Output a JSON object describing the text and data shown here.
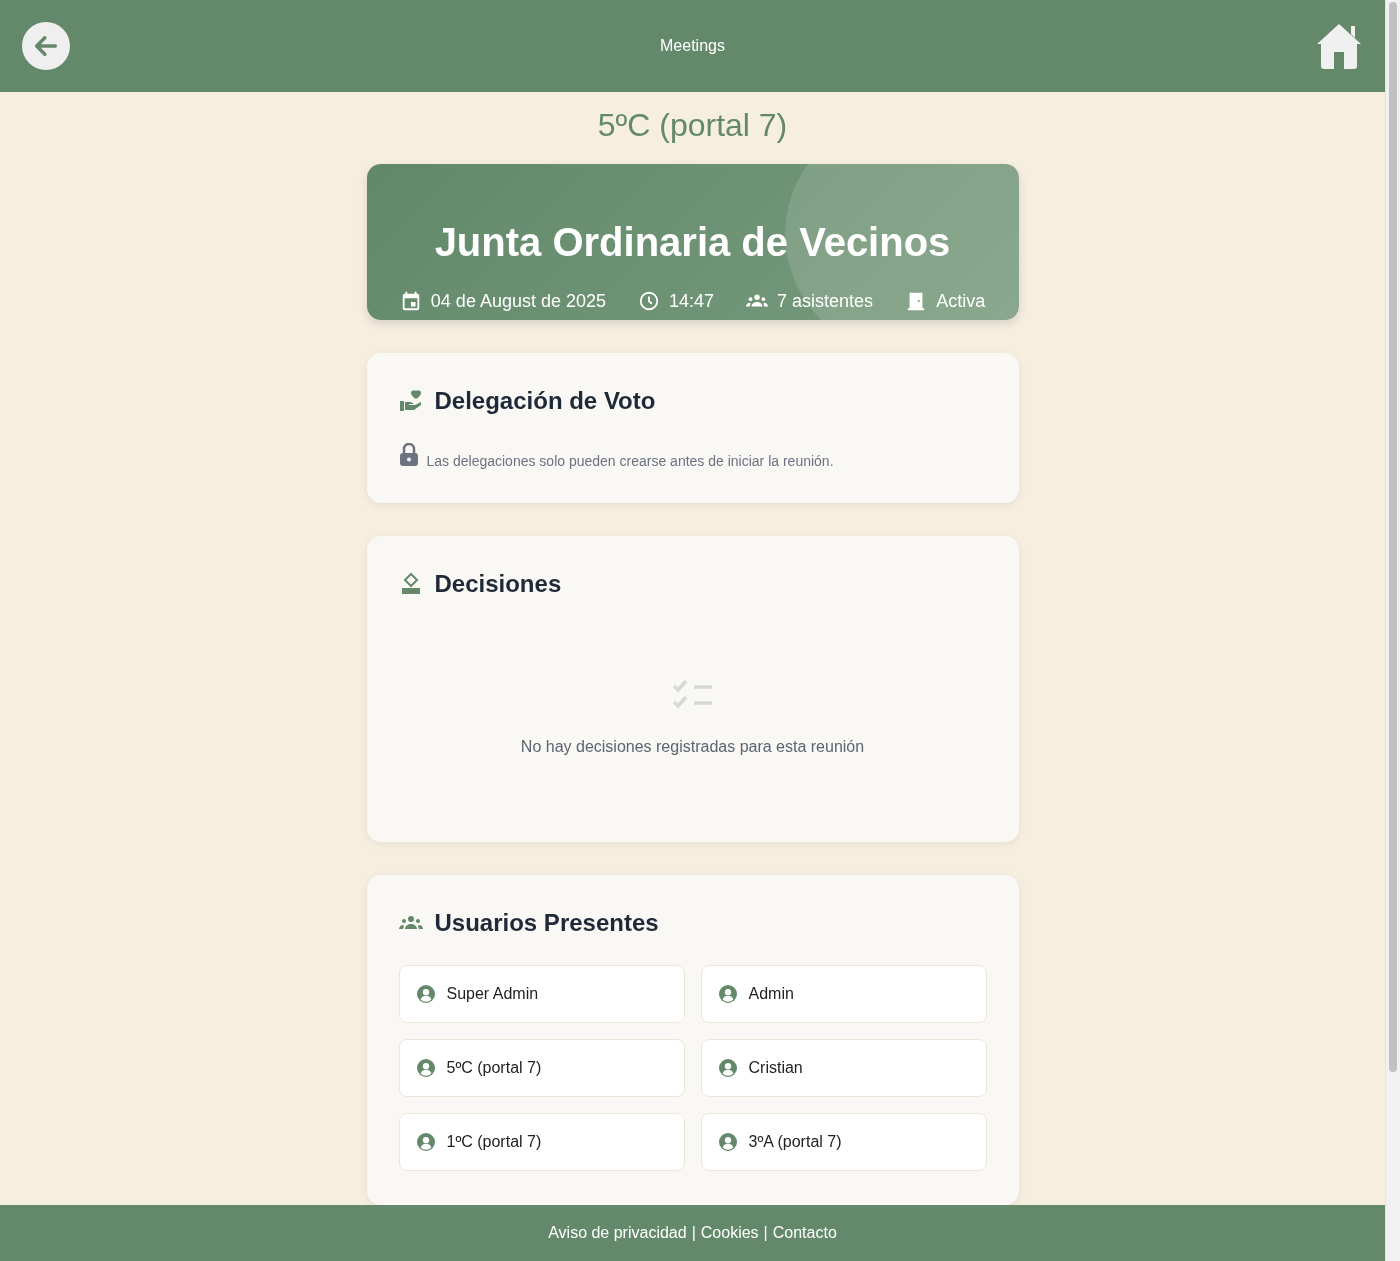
{
  "header": {
    "title": "Meetings"
  },
  "page_title": "5ºC (portal 7)",
  "meeting": {
    "title": "Junta Ordinaria de Vecinos",
    "meta": [
      {
        "kind": "date",
        "text": "04 de August de 2025"
      },
      {
        "kind": "time",
        "text": "14:47"
      },
      {
        "kind": "attendees",
        "text": "7 asistentes"
      },
      {
        "kind": "status",
        "text": "Activa"
      }
    ]
  },
  "delegation": {
    "title": "Delegación de Voto",
    "notice": "Las delegaciones solo pueden crearse antes de iniciar la reunión."
  },
  "decisions": {
    "title": "Decisiones",
    "empty_message": "No hay decisiones registradas para esta reunión"
  },
  "present_users": {
    "title": "Usuarios Presentes",
    "users": [
      "Super Admin",
      "Admin",
      "5ºC (portal 7)",
      "Cristian",
      "1ºC (portal 7)",
      "3ºA (portal 7)"
    ]
  },
  "footer": {
    "links": [
      "Aviso de privacidad",
      "Cookies",
      "Contacto"
    ],
    "separator": "|"
  }
}
